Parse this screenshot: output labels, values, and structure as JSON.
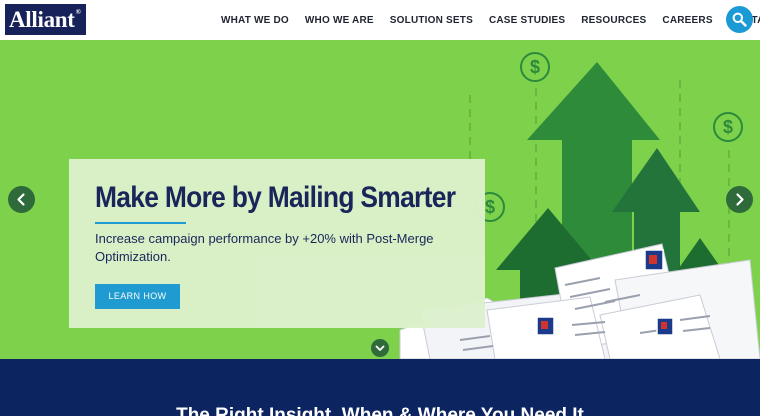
{
  "header": {
    "logo_text": "Alliant",
    "logo_mark": "®",
    "nav": [
      {
        "label": "WHAT WE DO"
      },
      {
        "label": "WHO WE ARE"
      },
      {
        "label": "SOLUTION SETS"
      },
      {
        "label": "CASE STUDIES"
      },
      {
        "label": "RESOURCES"
      },
      {
        "label": "CAREERS"
      },
      {
        "label": "CONTACT US"
      }
    ],
    "search_icon": "search-icon"
  },
  "hero": {
    "title": "Make More by Mailing Smarter",
    "subtitle": "Increase campaign performance by +20% with Post-Merge Optimization.",
    "button_label": "LEARN HOW",
    "prev_icon": "chevron-left-icon",
    "next_icon": "chevron-right-icon",
    "scroll_icon": "chevron-down-icon"
  },
  "band": {
    "heading": "The Right Insight, When & Where You Need It"
  },
  "colors": {
    "navy": "#17215a",
    "accent_blue": "#1c9ad6",
    "hero_green": "#7ed14a",
    "card_bg": "#dcf1cc",
    "arrow_dark": "#1f7a2e",
    "band_navy": "#0c2460"
  }
}
